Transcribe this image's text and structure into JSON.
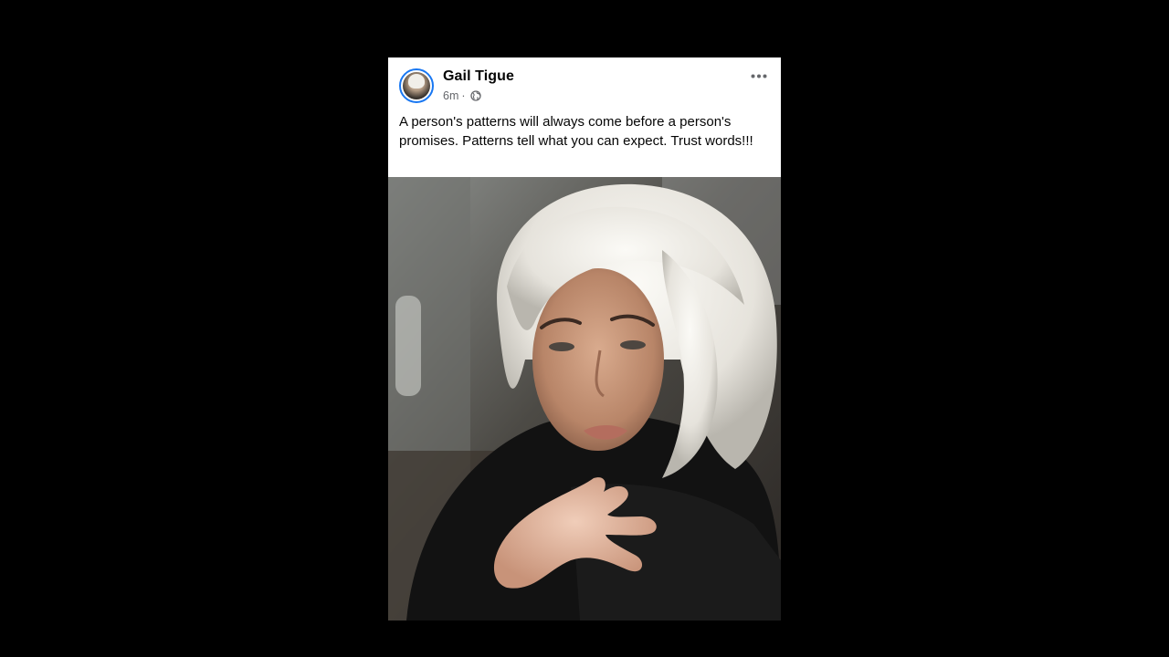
{
  "post": {
    "author": "Gail Tigue",
    "time": "6m",
    "separator": "·",
    "privacy_icon": "globe-icon",
    "more_icon": "more-options-icon",
    "text": "A person's patterns will always come before a person's promises. Patterns tell what you can expect. Trust words!!!",
    "accent_color": "#1877f2"
  }
}
